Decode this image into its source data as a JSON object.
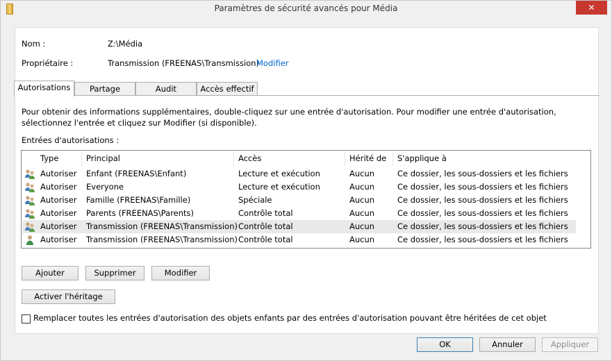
{
  "window": {
    "title": "Paramètres de sécurité avancés pour Média",
    "close_label": "✕"
  },
  "info": {
    "name_label": "Nom :",
    "name_value": "Z:\\Média",
    "owner_label": "Propriétaire :",
    "owner_value": "Transmission (FREENAS\\Transmission)",
    "owner_change_link": "Modifier"
  },
  "tabs": [
    {
      "label": "Autorisations"
    },
    {
      "label": "Partage"
    },
    {
      "label": "Audit"
    },
    {
      "label": "Accès effectif"
    }
  ],
  "description": "Pour obtenir des informations supplémentaires, double-cliquez sur une entrée d'autorisation. Pour modifier une entrée d'autorisation, sélectionnez l'entrée et cliquez sur Modifier (si disponible).",
  "entries_label": "Entrées d'autorisations :",
  "columns": [
    "Type",
    "Principal",
    "Accès",
    "Hérité de",
    "S'applique à"
  ],
  "rows": [
    {
      "type": "Autoriser",
      "principal": "Enfant (FREENAS\\Enfant)",
      "access": "Lecture et exécution",
      "inherited": "Aucun",
      "applies": "Ce dossier, les sous-dossiers et les fichiers",
      "icon": "group-icon"
    },
    {
      "type": "Autoriser",
      "principal": "Everyone",
      "access": "Lecture et exécution",
      "inherited": "Aucun",
      "applies": "Ce dossier, les sous-dossiers et les fichiers",
      "icon": "group-icon"
    },
    {
      "type": "Autoriser",
      "principal": "Famille (FREENAS\\Famille)",
      "access": "Spéciale",
      "inherited": "Aucun",
      "applies": "Ce dossier, les sous-dossiers et les fichiers",
      "icon": "group-icon"
    },
    {
      "type": "Autoriser",
      "principal": "Parents (FREENAS\\Parents)",
      "access": "Contrôle total",
      "inherited": "Aucun",
      "applies": "Ce dossier, les sous-dossiers et les fichiers",
      "icon": "group-icon"
    },
    {
      "type": "Autoriser",
      "principal": "Transmission (FREENAS\\Transmission)",
      "access": "Contrôle total",
      "inherited": "Aucun",
      "applies": "Ce dossier, les sous-dossiers et les fichiers",
      "icon": "group-icon"
    },
    {
      "type": "Autoriser",
      "principal": "Transmission (FREENAS\\Transmission)",
      "access": "Contrôle total",
      "inherited": "Aucun",
      "applies": "Ce dossier, les sous-dossiers et les fichiers",
      "icon": "user-icon"
    }
  ],
  "buttons": {
    "add": "Ajouter",
    "remove": "Supprimer",
    "edit": "Modifier",
    "enable_inheritance": "Activer l'héritage",
    "ok": "OK",
    "cancel": "Annuler",
    "apply": "Appliquer"
  },
  "replace_checkbox_label": "Remplacer toutes les entrées d'autorisation des objets enfants par des entrées d'autorisation pouvant être héritées de cet objet"
}
